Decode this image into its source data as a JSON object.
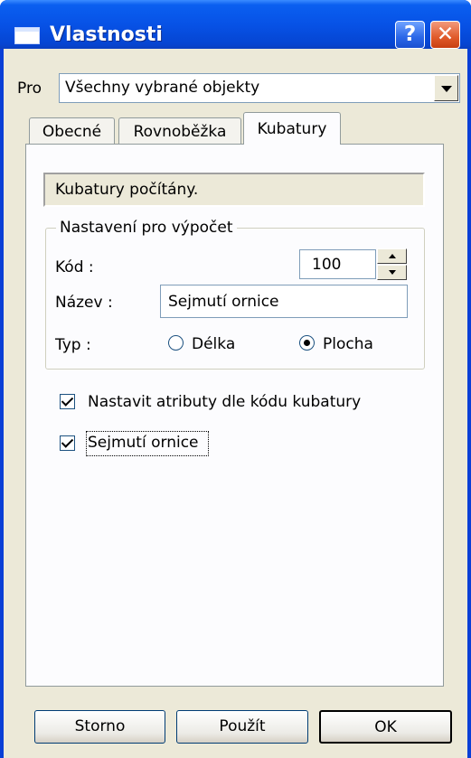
{
  "window": {
    "title": "Vlastnosti",
    "help_label": "?",
    "close_label": "✕"
  },
  "pro": {
    "label": "Pro",
    "value": "Všechny vybrané objekty"
  },
  "tabs": [
    {
      "label": "Obecné",
      "active": false
    },
    {
      "label": "Rovnoběžka",
      "active": false
    },
    {
      "label": "Kubatury",
      "active": true
    }
  ],
  "status": "Kubatury počítány.",
  "settings": {
    "group_title": "Nastavení pro výpočet",
    "code_label": "Kód :",
    "code_value": "100",
    "name_label": "Název :",
    "name_value": "Sejmutí ornice",
    "type_label": "Typ :",
    "type_options": [
      {
        "label": "Délka",
        "selected": false
      },
      {
        "label": "Plocha",
        "selected": true
      }
    ]
  },
  "checkboxes": [
    {
      "label": "Nastavit atributy dle kódu kubatury",
      "checked": true
    },
    {
      "label": "Sejmutí ornice",
      "checked": true
    }
  ],
  "buttons": {
    "cancel": "Storno",
    "apply": "Použít",
    "ok": "OK"
  },
  "colors": {
    "titlebar": "#0a5ff0",
    "dialog_bg": "#ece9d8",
    "tab_panel_bg": "#fcfcfe"
  }
}
